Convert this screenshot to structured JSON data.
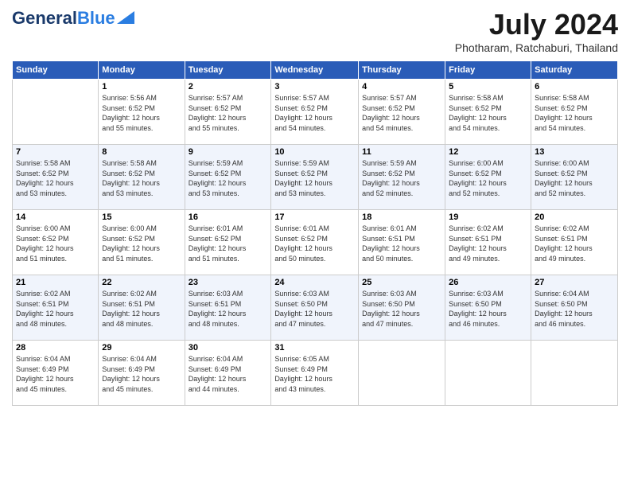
{
  "header": {
    "logo_general": "General",
    "logo_blue": "Blue",
    "month_year": "July 2024",
    "location": "Photharam, Ratchaburi, Thailand"
  },
  "days_of_week": [
    "Sunday",
    "Monday",
    "Tuesday",
    "Wednesday",
    "Thursday",
    "Friday",
    "Saturday"
  ],
  "weeks": [
    [
      {
        "day": "",
        "info": ""
      },
      {
        "day": "1",
        "info": "Sunrise: 5:56 AM\nSunset: 6:52 PM\nDaylight: 12 hours\nand 55 minutes."
      },
      {
        "day": "2",
        "info": "Sunrise: 5:57 AM\nSunset: 6:52 PM\nDaylight: 12 hours\nand 55 minutes."
      },
      {
        "day": "3",
        "info": "Sunrise: 5:57 AM\nSunset: 6:52 PM\nDaylight: 12 hours\nand 54 minutes."
      },
      {
        "day": "4",
        "info": "Sunrise: 5:57 AM\nSunset: 6:52 PM\nDaylight: 12 hours\nand 54 minutes."
      },
      {
        "day": "5",
        "info": "Sunrise: 5:58 AM\nSunset: 6:52 PM\nDaylight: 12 hours\nand 54 minutes."
      },
      {
        "day": "6",
        "info": "Sunrise: 5:58 AM\nSunset: 6:52 PM\nDaylight: 12 hours\nand 54 minutes."
      }
    ],
    [
      {
        "day": "7",
        "info": "Sunrise: 5:58 AM\nSunset: 6:52 PM\nDaylight: 12 hours\nand 53 minutes."
      },
      {
        "day": "8",
        "info": "Sunrise: 5:58 AM\nSunset: 6:52 PM\nDaylight: 12 hours\nand 53 minutes."
      },
      {
        "day": "9",
        "info": "Sunrise: 5:59 AM\nSunset: 6:52 PM\nDaylight: 12 hours\nand 53 minutes."
      },
      {
        "day": "10",
        "info": "Sunrise: 5:59 AM\nSunset: 6:52 PM\nDaylight: 12 hours\nand 53 minutes."
      },
      {
        "day": "11",
        "info": "Sunrise: 5:59 AM\nSunset: 6:52 PM\nDaylight: 12 hours\nand 52 minutes."
      },
      {
        "day": "12",
        "info": "Sunrise: 6:00 AM\nSunset: 6:52 PM\nDaylight: 12 hours\nand 52 minutes."
      },
      {
        "day": "13",
        "info": "Sunrise: 6:00 AM\nSunset: 6:52 PM\nDaylight: 12 hours\nand 52 minutes."
      }
    ],
    [
      {
        "day": "14",
        "info": "Sunrise: 6:00 AM\nSunset: 6:52 PM\nDaylight: 12 hours\nand 51 minutes."
      },
      {
        "day": "15",
        "info": "Sunrise: 6:00 AM\nSunset: 6:52 PM\nDaylight: 12 hours\nand 51 minutes."
      },
      {
        "day": "16",
        "info": "Sunrise: 6:01 AM\nSunset: 6:52 PM\nDaylight: 12 hours\nand 51 minutes."
      },
      {
        "day": "17",
        "info": "Sunrise: 6:01 AM\nSunset: 6:52 PM\nDaylight: 12 hours\nand 50 minutes."
      },
      {
        "day": "18",
        "info": "Sunrise: 6:01 AM\nSunset: 6:51 PM\nDaylight: 12 hours\nand 50 minutes."
      },
      {
        "day": "19",
        "info": "Sunrise: 6:02 AM\nSunset: 6:51 PM\nDaylight: 12 hours\nand 49 minutes."
      },
      {
        "day": "20",
        "info": "Sunrise: 6:02 AM\nSunset: 6:51 PM\nDaylight: 12 hours\nand 49 minutes."
      }
    ],
    [
      {
        "day": "21",
        "info": "Sunrise: 6:02 AM\nSunset: 6:51 PM\nDaylight: 12 hours\nand 48 minutes."
      },
      {
        "day": "22",
        "info": "Sunrise: 6:02 AM\nSunset: 6:51 PM\nDaylight: 12 hours\nand 48 minutes."
      },
      {
        "day": "23",
        "info": "Sunrise: 6:03 AM\nSunset: 6:51 PM\nDaylight: 12 hours\nand 48 minutes."
      },
      {
        "day": "24",
        "info": "Sunrise: 6:03 AM\nSunset: 6:50 PM\nDaylight: 12 hours\nand 47 minutes."
      },
      {
        "day": "25",
        "info": "Sunrise: 6:03 AM\nSunset: 6:50 PM\nDaylight: 12 hours\nand 47 minutes."
      },
      {
        "day": "26",
        "info": "Sunrise: 6:03 AM\nSunset: 6:50 PM\nDaylight: 12 hours\nand 46 minutes."
      },
      {
        "day": "27",
        "info": "Sunrise: 6:04 AM\nSunset: 6:50 PM\nDaylight: 12 hours\nand 46 minutes."
      }
    ],
    [
      {
        "day": "28",
        "info": "Sunrise: 6:04 AM\nSunset: 6:49 PM\nDaylight: 12 hours\nand 45 minutes."
      },
      {
        "day": "29",
        "info": "Sunrise: 6:04 AM\nSunset: 6:49 PM\nDaylight: 12 hours\nand 45 minutes."
      },
      {
        "day": "30",
        "info": "Sunrise: 6:04 AM\nSunset: 6:49 PM\nDaylight: 12 hours\nand 44 minutes."
      },
      {
        "day": "31",
        "info": "Sunrise: 6:05 AM\nSunset: 6:49 PM\nDaylight: 12 hours\nand 43 minutes."
      },
      {
        "day": "",
        "info": ""
      },
      {
        "day": "",
        "info": ""
      },
      {
        "day": "",
        "info": ""
      }
    ]
  ]
}
